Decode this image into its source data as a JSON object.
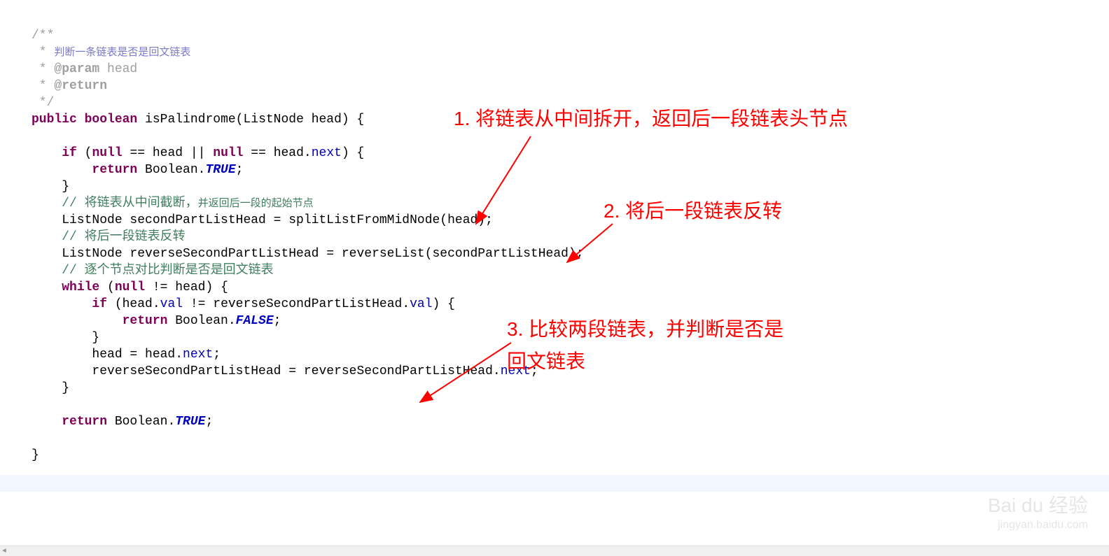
{
  "code": {
    "l01": "/**",
    "l02_a": " * ",
    "l02_b": "判断一条链表是否是回文链表",
    "l03_a": " * ",
    "l03_b": "@param",
    "l03_c": " head",
    "l04_a": " * ",
    "l04_b": "@return",
    "l05": " */",
    "l06_a": "public",
    "l06_b": " ",
    "l06_c": "boolean",
    "l06_d": " isPalindrome(ListNode head) {",
    "l07": "",
    "l08_a": "    ",
    "l08_b": "if",
    "l08_c": " (",
    "l08_d": "null",
    "l08_e": " == head || ",
    "l08_f": "null",
    "l08_g": " == head.",
    "l08_h": "next",
    "l08_i": ") {",
    "l09_a": "        ",
    "l09_b": "return",
    "l09_c": " Boolean.",
    "l09_d": "TRUE",
    "l09_e": ";",
    "l10": "    }",
    "l11_a": "    ",
    "l11_b": "// 将链表从中间截断，",
    "l11_c": "并返回后一段的起始节点",
    "l12": "    ListNode secondPartListHead = splitListFromMidNode(head);",
    "l13_a": "    ",
    "l13_b": "// 将后一段链表反转",
    "l14": "    ListNode reverseSecondPartListHead = reverseList(secondPartListHead);",
    "l15_a": "    ",
    "l15_b": "// 逐个节点对比判断是否是回文链表",
    "l16_a": "    ",
    "l16_b": "while",
    "l16_c": " (",
    "l16_d": "null",
    "l16_e": " != head) {",
    "l17_a": "        ",
    "l17_b": "if",
    "l17_c": " (head.",
    "l17_d": "val",
    "l17_e": " != reverseSecondPartListHead.",
    "l17_f": "val",
    "l17_g": ") {",
    "l18_a": "            ",
    "l18_b": "return",
    "l18_c": " Boolean.",
    "l18_d": "FALSE",
    "l18_e": ";",
    "l19": "        }",
    "l20_a": "        head = head.",
    "l20_b": "next",
    "l20_c": ";",
    "l21_a": "        reverseSecondPartListHead = reverseSecondPartListHead.",
    "l21_b": "next",
    "l21_c": ";",
    "l22": "    }",
    "l23": "",
    "l24_a": "    ",
    "l24_b": "return",
    "l24_c": " Boolean.",
    "l24_d": "TRUE",
    "l24_e": ";",
    "l25": "    ",
    "l26": "}"
  },
  "annotations": {
    "a1": "1. 将链表从中间拆开，返回后一段链表头节点",
    "a2": "2. 将后一段链表反转",
    "a3_line1": "3. 比较两段链表，并判断是否是",
    "a3_line2": "回文链表"
  },
  "watermark": {
    "main": "Bai du 经验",
    "sub": "jingyan.baidu.com"
  }
}
